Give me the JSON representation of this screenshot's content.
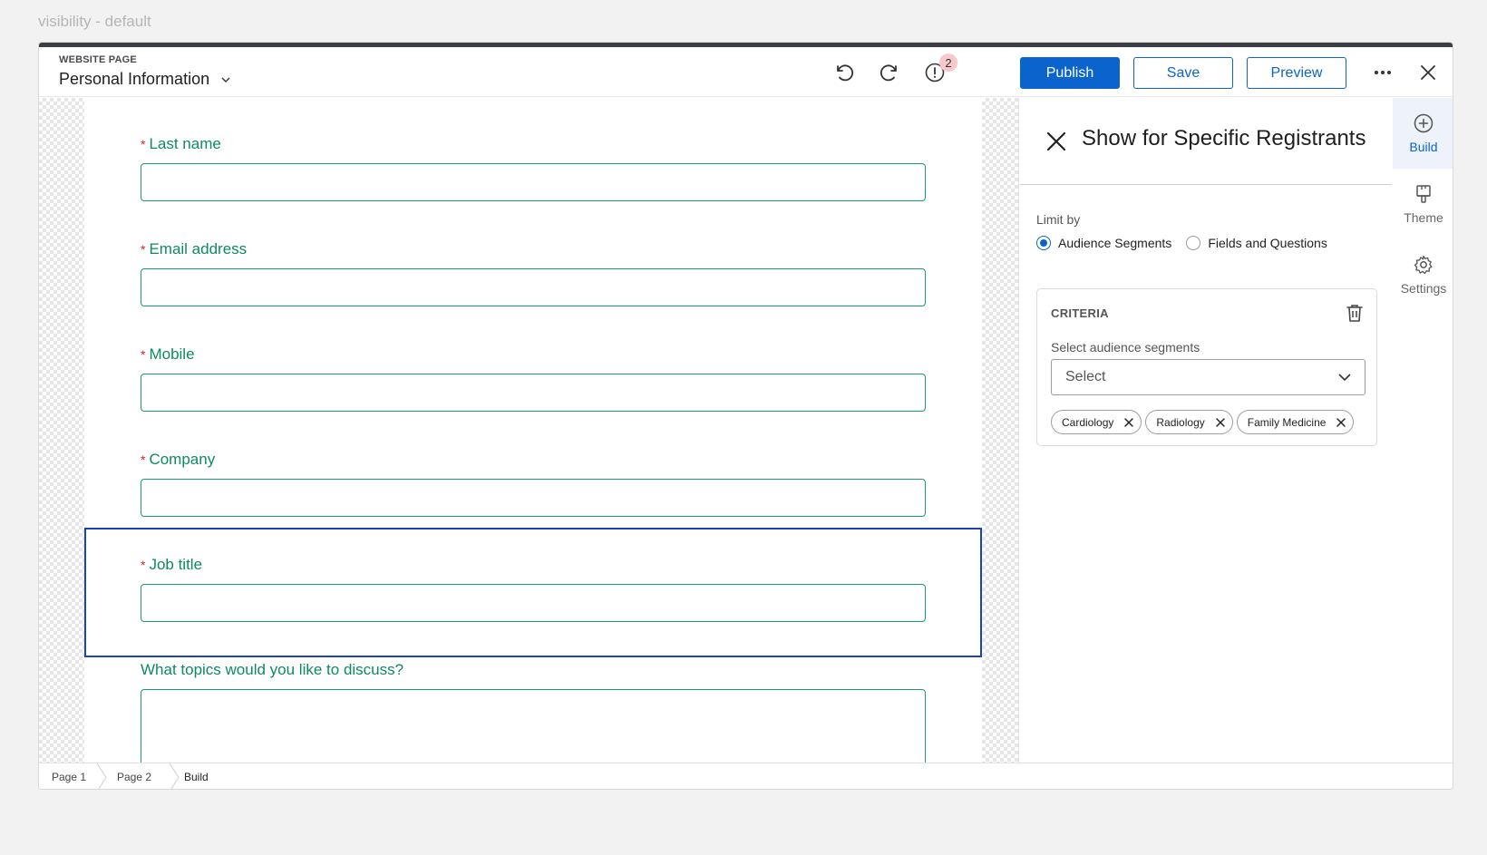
{
  "caption": "visibility - default",
  "header": {
    "subtitle": "WEBSITE PAGE",
    "title": "Personal Information",
    "alerts_count": "2",
    "publish_label": "Publish",
    "save_label": "Save",
    "preview_label": "Preview"
  },
  "form": {
    "fields": [
      {
        "label": "Last name",
        "required": true
      },
      {
        "label": "Email address",
        "required": true
      },
      {
        "label": "Mobile",
        "required": true
      },
      {
        "label": "Company",
        "required": true
      },
      {
        "label": "Job title",
        "required": true
      },
      {
        "label": "What topics would you like to discuss?",
        "required": false
      }
    ],
    "required_marker": "*"
  },
  "panel": {
    "title": "Show for Specific Registrants",
    "limit_by_label": "Limit by",
    "options": [
      {
        "label": "Audience Segments",
        "selected": true
      },
      {
        "label": "Fields and Questions",
        "selected": false
      }
    ],
    "criteria": {
      "title": "CRITERIA",
      "select_label": "Select audience segments",
      "select_placeholder": "Select",
      "tags": [
        "Cardiology",
        "Radiology",
        "Family Medicine"
      ]
    }
  },
  "rail": {
    "items": [
      {
        "label": "Build",
        "icon": "plus-circle-icon",
        "active": true
      },
      {
        "label": "Theme",
        "icon": "paint-brush-icon",
        "active": false
      },
      {
        "label": "Settings",
        "icon": "gear-icon",
        "active": false
      }
    ]
  },
  "footer": {
    "breadcrumbs": [
      "Page 1",
      "Page 2",
      "Build"
    ]
  },
  "colors": {
    "primary": "#0b63ce",
    "field_label": "#0e8a62",
    "field_border": "#1a9a70",
    "required": "#dd2222",
    "selection_outline": "#1b43b8"
  }
}
